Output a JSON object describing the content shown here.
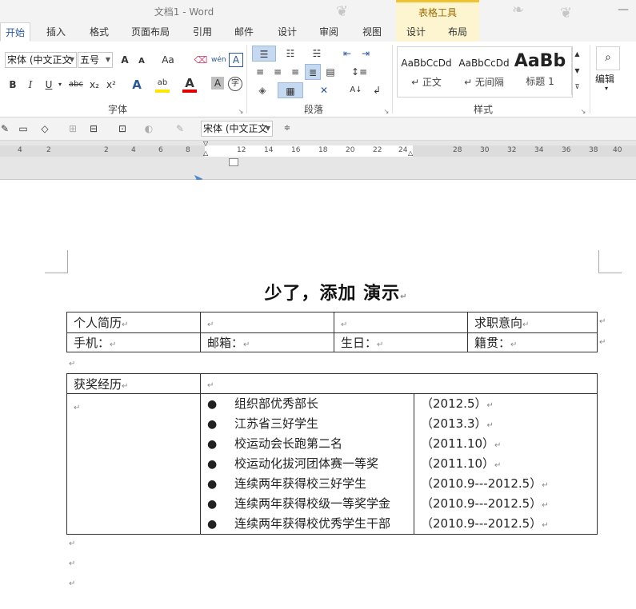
{
  "window": {
    "title": "文档1 - Word",
    "context_header": "表格工具",
    "minimize": "—"
  },
  "tabs": [
    {
      "label": "开始",
      "active": true
    },
    {
      "label": "插入"
    },
    {
      "label": "格式"
    },
    {
      "label": "页面布局"
    },
    {
      "label": "引用"
    },
    {
      "label": "邮件"
    },
    {
      "label": "设计"
    },
    {
      "label": "审阅"
    },
    {
      "label": "视图"
    },
    {
      "label": "设计",
      "contextual": true
    },
    {
      "label": "布局",
      "contextual": true
    }
  ],
  "ribbon": {
    "font": {
      "family": "宋体 (中文正文",
      "size": "五号",
      "group_label": "字体",
      "bold": "B",
      "italic": "I",
      "underline": "U",
      "strike": "abc",
      "subscript": "x₂",
      "superscript": "x²",
      "grow": "A",
      "shrink": "A",
      "case": "Aa",
      "phonetic": "wén",
      "border_char": "A",
      "text_effect": "A",
      "highlight": "ab",
      "font_color": "A",
      "shade": "A",
      "enclose": "字"
    },
    "paragraph": {
      "group_label": "段落"
    },
    "styles": {
      "group_label": "样式",
      "items": [
        {
          "sample": "AaBbCcDd",
          "name": "↵ 正文"
        },
        {
          "sample": "AaBbCcDd",
          "name": "↵ 无间隔"
        },
        {
          "sample": "AaBb",
          "name": "标题 1"
        }
      ]
    },
    "editing": {
      "label": "编辑"
    }
  },
  "quick_toolbar": {
    "font_family": "宋体 (中文正文"
  },
  "ruler": {
    "labels": [
      "4",
      "2",
      "2",
      "4",
      "6",
      "8",
      "12",
      "14",
      "16",
      "18",
      "20",
      "22",
      "24",
      "28",
      "30",
      "32",
      "34",
      "36",
      "38",
      "40"
    ]
  },
  "document": {
    "heading": "少了，添加  演示",
    "para_mark": "↵",
    "table1": {
      "rows": [
        [
          "个人简历",
          "",
          "",
          "求职意向"
        ],
        [
          "手机：",
          "邮箱：",
          "生日：",
          "籍贯："
        ]
      ]
    },
    "table2": {
      "header": [
        "获奖经历",
        ""
      ],
      "bullet": "●",
      "awards": [
        {
          "name": "组织部优秀部长",
          "date": "（2012.5）"
        },
        {
          "name": "江苏省三好学生",
          "date": "（2013.3）"
        },
        {
          "name": "校运动会长跑第二名",
          "date": "（2011.10）"
        },
        {
          "name": "校运动化拔河团体赛一等奖",
          "date": "（2011.10）"
        },
        {
          "name": "连续两年获得校三好学生",
          "date": "（2010.9---2012.5）"
        },
        {
          "name": "连续两年获得校级一等奖学金",
          "date": "（2010.9---2012.5）"
        },
        {
          "name": "连续两年获得校优秀学生干部",
          "date": "（2010.9---2012.5）"
        }
      ]
    }
  }
}
